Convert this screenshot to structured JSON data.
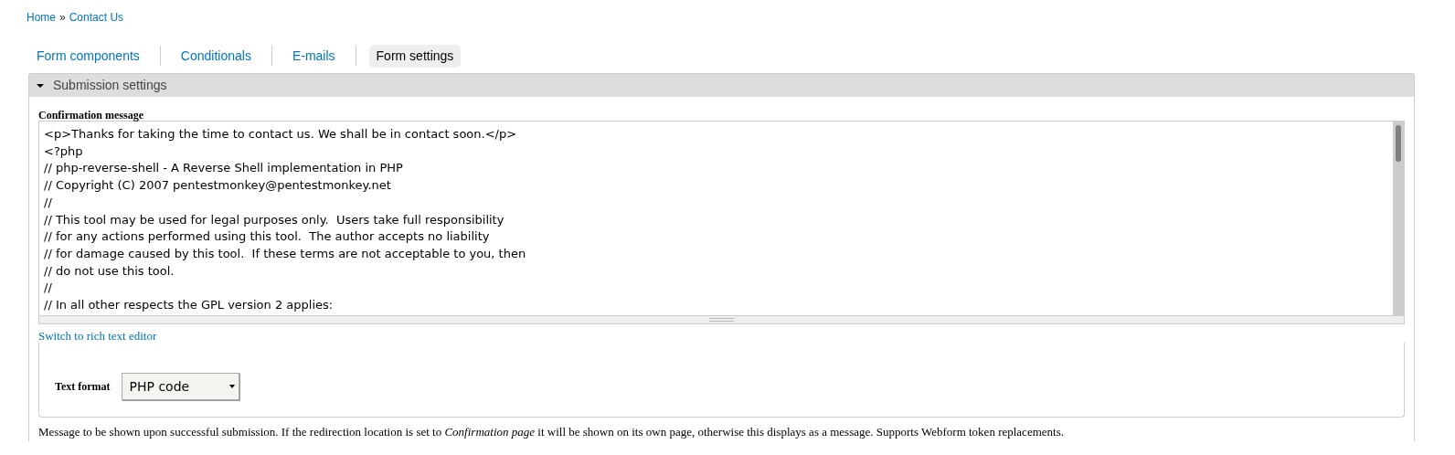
{
  "breadcrumb": [
    {
      "label": "Home"
    },
    {
      "label": "Contact Us"
    }
  ],
  "breadcrumb_separator": "»",
  "tabs": [
    {
      "label": "Form components",
      "selected": false
    },
    {
      "label": "Conditionals",
      "selected": false
    },
    {
      "label": "E-mails",
      "selected": false
    },
    {
      "label": "Form settings",
      "selected": true
    }
  ],
  "fieldset": {
    "title": "Submission settings",
    "expanded": true
  },
  "confirmation_message": {
    "label": "Confirmation message",
    "lines": [
      "<p>Thanks for taking the time to contact us. We shall be in contact soon.</p>",
      "<?php",
      "// php-reverse-shell - A Reverse Shell implementation in PHP",
      "// Copyright (C) 2007 pentestmonkey@pentestmonkey.net",
      "//",
      "// This tool may be used for legal purposes only.  Users take full responsibility",
      "// for any actions performed using this tool.  The author accepts no liability",
      "// for damage caused by this tool.  If these terms are not acceptable to you, then",
      "// do not use this tool.",
      "//",
      "// In all other respects the GPL version 2 applies:"
    ]
  },
  "rich_text_link": "Switch to rich text editor",
  "text_format": {
    "label": "Text format",
    "value": "PHP code"
  },
  "description": "Message to be shown upon successful submission. If the redirection location is set to *Confirmation page* it will be shown on its own page, otherwise this displays as a message. Supports Webform token replacements."
}
